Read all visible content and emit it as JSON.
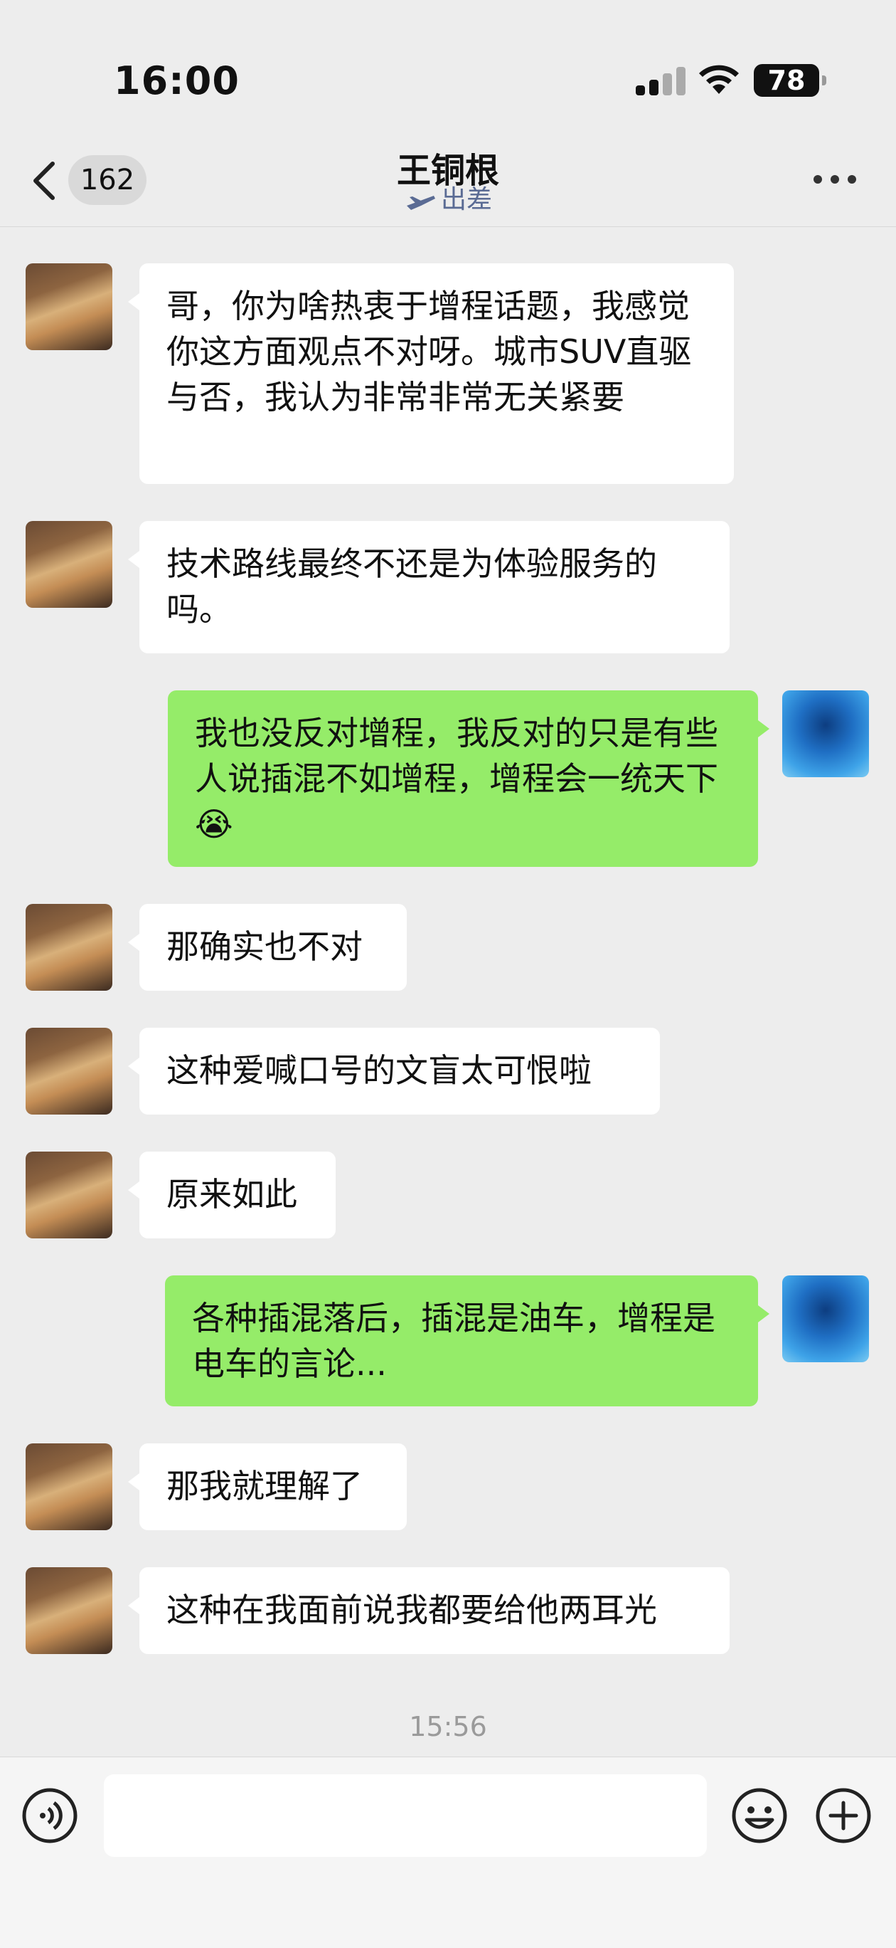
{
  "status_bar": {
    "time": "16:00",
    "battery": "78"
  },
  "nav": {
    "back_count": "162",
    "title": "王铜根",
    "subtitle": "出差"
  },
  "messages": [
    {
      "side": "in",
      "text": "哥，你为啥热衷于增程话题，我感觉你这方面观点不对呀。城市SUV直驱与否，我认为非常非常无关紧要"
    },
    {
      "side": "in",
      "text": "技术路线最终不还是为体验服务的吗。"
    },
    {
      "side": "out",
      "text": "我也没反对增程，我反对的只是有些人说插混不如增程，增程会一统天下",
      "emoji": "😭"
    },
    {
      "side": "in",
      "text": "那确实也不对"
    },
    {
      "side": "in",
      "text": "这种爱喊口号的文盲太可恨啦"
    },
    {
      "side": "in",
      "text": "原来如此"
    },
    {
      "side": "out",
      "text": "各种插混落后，插混是油车，增程是电车的言论..."
    },
    {
      "side": "in",
      "text": "那我就理解了"
    },
    {
      "side": "in",
      "text": "这种在我面前说我都要给他两耳光"
    }
  ],
  "timestamp": "15:56",
  "input": {
    "placeholder": ""
  },
  "icons": {
    "voice": "voice-icon",
    "emoji": "emoji-icon",
    "plus": "plus-icon",
    "more": "more-icon",
    "back": "back-chevron-icon",
    "plane": "plane-icon"
  },
  "colors": {
    "background": "#ededed",
    "incoming": "#ffffff",
    "outgoing": "#95ec69",
    "subtitle": "#5a6b94"
  }
}
